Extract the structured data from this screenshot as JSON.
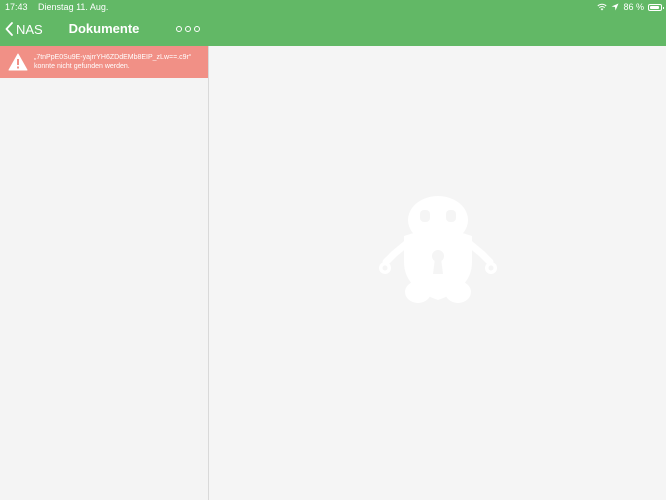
{
  "status_bar": {
    "time": "17:43",
    "date": "Dienstag 11. Aug.",
    "battery": "86 %"
  },
  "nav": {
    "back_label": "NAS",
    "title": "Dokumente"
  },
  "error_banner": {
    "line1": "„7tnPpE0Su9E-yajrrYH6ZDdEMb8EIP_zLw==.c9r“",
    "line2": "konnte nicht gefunden werden."
  },
  "colors": {
    "header": "#62b866",
    "error": "#f19086",
    "background": "#f5f5f5"
  },
  "icons": [
    "chevron-left-icon",
    "more-icon",
    "warning-icon",
    "wifi-icon",
    "location-icon",
    "battery-icon",
    "mascot-icon"
  ]
}
